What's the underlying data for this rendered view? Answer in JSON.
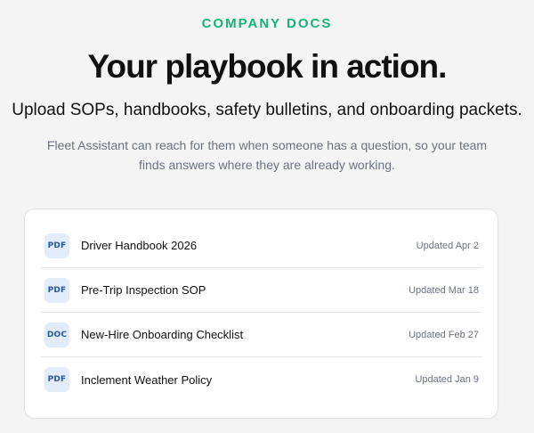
{
  "header": {
    "eyebrow": "COMPANY DOCS",
    "headline": "Your playbook in action.",
    "subhead": "Upload SOPs, handbooks, safety bulletins, and onboarding packets.",
    "description": "Fleet Assistant can reach for them when someone has a question, so your team finds answers where they are already working."
  },
  "colors": {
    "accent": "#16b377",
    "badge_bg": "#e3ecfb",
    "badge_text": "#2455a6"
  },
  "documents": [
    {
      "type": "PDF",
      "icon": "pdf-file-icon",
      "name": "Driver Handbook 2026",
      "updated": "Updated Apr 2"
    },
    {
      "type": "PDF",
      "icon": "pdf-file-icon",
      "name": "Pre-Trip Inspection SOP",
      "updated": "Updated Mar 18"
    },
    {
      "type": "DOC",
      "icon": "doc-file-icon",
      "name": "New-Hire Onboarding Checklist",
      "updated": "Updated Feb 27"
    },
    {
      "type": "PDF",
      "icon": "pdf-file-icon",
      "name": "Inclement Weather Policy",
      "updated": "Updated Jan 9"
    }
  ]
}
